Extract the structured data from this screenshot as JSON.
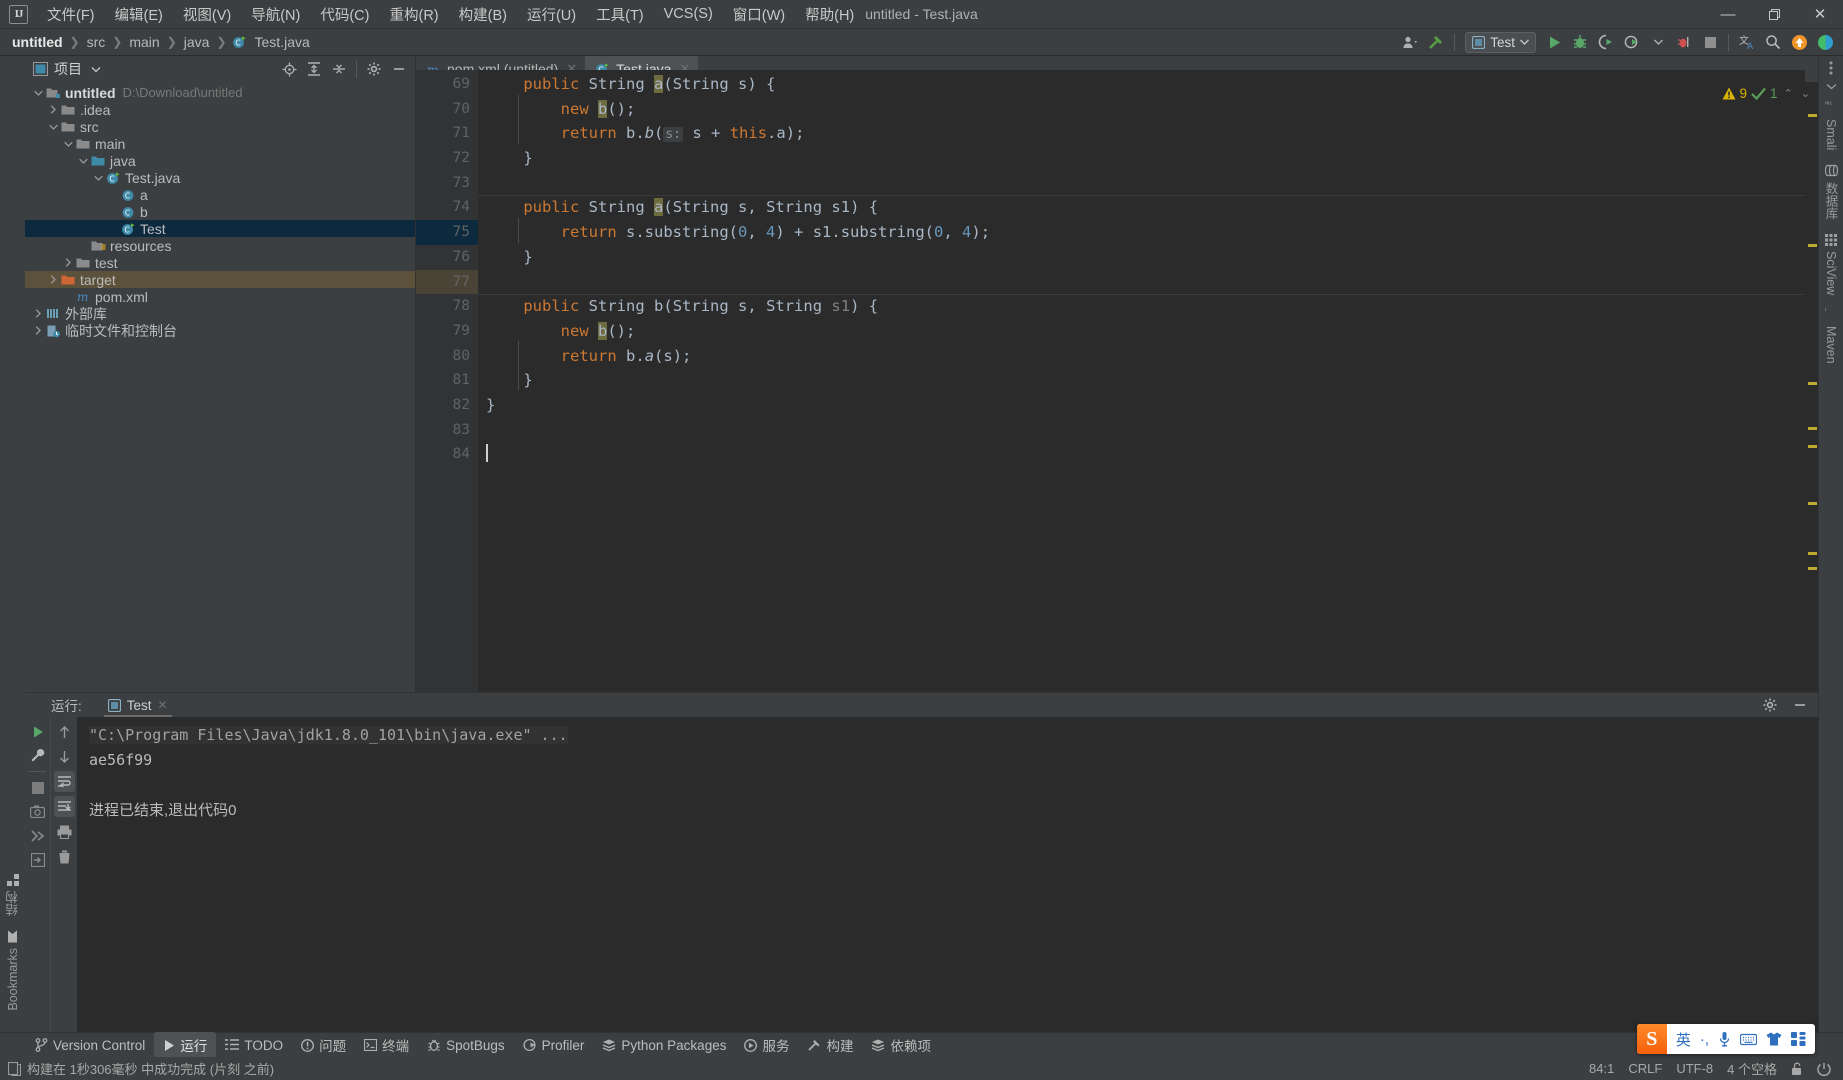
{
  "window": {
    "title": "untitled - Test.java",
    "app_logo": "IJ",
    "minimize": "—",
    "maximize": "❐",
    "close": "✕"
  },
  "menubar": {
    "items": [
      {
        "label": "文件(F)",
        "name": "menu-file"
      },
      {
        "label": "编辑(E)",
        "name": "menu-edit"
      },
      {
        "label": "视图(V)",
        "name": "menu-view"
      },
      {
        "label": "导航(N)",
        "name": "menu-navigate"
      },
      {
        "label": "代码(C)",
        "name": "menu-code"
      },
      {
        "label": "重构(R)",
        "name": "menu-refactor"
      },
      {
        "label": "构建(B)",
        "name": "menu-build"
      },
      {
        "label": "运行(U)",
        "name": "menu-run"
      },
      {
        "label": "工具(T)",
        "name": "menu-tools"
      },
      {
        "label": "VCS(S)",
        "name": "menu-vcs"
      },
      {
        "label": "窗口(W)",
        "name": "menu-window"
      },
      {
        "label": "帮助(H)",
        "name": "menu-help"
      }
    ]
  },
  "navbar": {
    "breadcrumbs": [
      "untitled",
      "src",
      "main",
      "java",
      "Test.java"
    ],
    "separator": "❯",
    "run_config": "Test",
    "toolbar_icons": [
      "user-icon",
      "hammer-icon",
      "run-icon",
      "debug-icon",
      "run-coverage-icon",
      "profiler-icon",
      "stop-icon",
      "translate-icon",
      "search-everywhere-icon",
      "update-icon",
      "ide-theme-icon"
    ]
  },
  "left_rail": {
    "tabs": [
      {
        "label": "结构",
        "name": "rail-structure"
      },
      {
        "label": "Bookmarks",
        "name": "rail-bookmarks"
      }
    ]
  },
  "right_rail": {
    "tabs": [
      {
        "label": "Smali",
        "name": "rail-smali"
      },
      {
        "label": "数据库",
        "name": "rail-database"
      },
      {
        "label": "SciView",
        "name": "rail-sciview"
      },
      {
        "label": "Maven",
        "name": "rail-maven"
      }
    ]
  },
  "project_panel": {
    "title": "项目",
    "header_icons": [
      "locate-icon",
      "expand-all-icon",
      "collapse-all-icon",
      "settings-icon",
      "hide-icon"
    ],
    "tree": [
      {
        "label": "untitled",
        "sub": "D:\\Download\\untitled",
        "depth": 0,
        "arrow": "down",
        "icon": "module-folder",
        "state": "normal"
      },
      {
        "label": ".idea",
        "sub": "",
        "depth": 1,
        "arrow": "right",
        "icon": "folder",
        "state": "normal"
      },
      {
        "label": "src",
        "sub": "",
        "depth": 1,
        "arrow": "down",
        "icon": "folder",
        "state": "normal"
      },
      {
        "label": "main",
        "sub": "",
        "depth": 2,
        "arrow": "down",
        "icon": "folder",
        "state": "normal"
      },
      {
        "label": "java",
        "sub": "",
        "depth": 3,
        "arrow": "down",
        "icon": "source-folder",
        "state": "normal"
      },
      {
        "label": "Test.java",
        "sub": "",
        "depth": 4,
        "arrow": "down",
        "icon": "java-class",
        "state": "normal"
      },
      {
        "label": "a",
        "sub": "",
        "depth": 5,
        "arrow": "none",
        "icon": "class",
        "state": "normal"
      },
      {
        "label": "b",
        "sub": "",
        "depth": 5,
        "arrow": "none",
        "icon": "class",
        "state": "normal"
      },
      {
        "label": "Test",
        "sub": "",
        "depth": 5,
        "arrow": "none",
        "icon": "java-class",
        "state": "selected"
      },
      {
        "label": "resources",
        "sub": "",
        "depth": 3,
        "arrow": "none",
        "icon": "resource-folder",
        "state": "normal"
      },
      {
        "label": "test",
        "sub": "",
        "depth": 2,
        "arrow": "right",
        "icon": "folder",
        "state": "normal"
      },
      {
        "label": "target",
        "sub": "",
        "depth": 1,
        "arrow": "right",
        "icon": "excluded-folder",
        "state": "highlight"
      },
      {
        "label": "pom.xml",
        "sub": "",
        "depth": 2,
        "arrow": "none",
        "icon": "maven-file",
        "state": "normal"
      },
      {
        "label": "外部库",
        "sub": "",
        "depth": 0,
        "arrow": "right",
        "icon": "library",
        "state": "normal"
      },
      {
        "label": "临时文件和控制台",
        "sub": "",
        "depth": 0,
        "arrow": "right",
        "icon": "scratches",
        "state": "normal"
      }
    ]
  },
  "editor": {
    "tabs": [
      {
        "label": "pom.xml (untitled)",
        "icon": "maven-file",
        "active": false,
        "name": "tab-pom-xml"
      },
      {
        "label": "Test.java",
        "icon": "java-class",
        "active": true,
        "name": "tab-test-java"
      }
    ],
    "inspection": {
      "warning_count": "9",
      "ok_count": "1",
      "chev_up": "⌃",
      "chev_down": "⌄"
    },
    "first_line": 69,
    "lines": [
      {
        "n": "69",
        "gutter": "",
        "clipped": true,
        "html": "    <span class='kw'>public</span> <span class='cls'>String</span> <span class='usage'>a</span>(<span class='cls'>String</span> <span class='id'>s</span>) {"
      },
      {
        "n": "70",
        "gutter": "",
        "clipped": false,
        "html": "        <span class='kw'>new</span> <span class='usage'>b</span>();"
      },
      {
        "n": "71",
        "gutter": "",
        "clipped": false,
        "html": "        <span class='kw'>return</span> <span class='id'>b</span>.<span class='ital'>b</span>(<span class='param-hint'>s:</span> <span class='id'>s</span> + <span class='kw'>this</span>.<span class='id'>a</span>);"
      },
      {
        "n": "72",
        "gutter": "",
        "clipped": false,
        "html": "    }"
      },
      {
        "n": "73",
        "gutter": "",
        "clipped": false,
        "html": ""
      },
      {
        "n": "74",
        "gutter": "@",
        "clipped": false,
        "sep": true,
        "html": "    <span class='kw'>public</span> <span class='cls'>String</span> <span class='usage'>a</span>(<span class='cls'>String</span> <span class='id'>s</span>, <span class='cls'>String</span> <span class='id'>s1</span>) {"
      },
      {
        "n": "75",
        "gutter": "",
        "clipped": false,
        "html": "        <span class='kw'>return</span> <span class='id'>s</span>.substring(<span class='num'>0</span>, <span class='num'>4</span>) + <span class='id'>s1</span>.substring(<span class='num'>0</span>, <span class='num'>4</span>);"
      },
      {
        "n": "76",
        "gutter": "",
        "clipped": false,
        "html": "    }"
      },
      {
        "n": "77",
        "gutter": "",
        "clipped": false,
        "html": ""
      },
      {
        "n": "78",
        "gutter": "",
        "clipped": false,
        "sep": true,
        "html": "    <span class='kw'>public</span> <span class='cls'>String</span> <span class='id'>b</span>(<span class='cls'>String</span> <span class='id'>s</span>, <span class='cls'>String</span> <span class='gray'>s1</span>) {"
      },
      {
        "n": "79",
        "gutter": "",
        "clipped": false,
        "html": "        <span class='kw'>new</span> <span class='usage'>b</span>();"
      },
      {
        "n": "80",
        "gutter": "",
        "clipped": false,
        "html": "        <span class='kw'>return</span> <span class='id'>b</span>.<span class='ital'>a</span>(<span class='id'>s</span>);"
      },
      {
        "n": "81",
        "gutter": "",
        "clipped": false,
        "html": "    }"
      },
      {
        "n": "82",
        "gutter": "",
        "clipped": false,
        "html": "}"
      },
      {
        "n": "83",
        "gutter": "",
        "clipped": false,
        "html": ""
      },
      {
        "n": "84",
        "gutter": "",
        "clipped": false,
        "caret": true,
        "html": ""
      }
    ]
  },
  "run_panel": {
    "label": "运行:",
    "tab": "Test",
    "close": "✕",
    "settings_icon": "gear-icon",
    "hide_icon": "minimize-icon",
    "toolbar_left": [
      "rerun-icon",
      "wrench-icon",
      "stop-icon",
      "camera-icon",
      "thread-dump-icon",
      "export-icon"
    ],
    "toolbar_right": [
      "up-icon",
      "down-icon",
      "soft-wrap-icon",
      "scroll-to-end-icon",
      "print-icon",
      "trash-icon"
    ],
    "console": {
      "command": "\"C:\\Program Files\\Java\\jdk1.8.0_101\\bin\\java.exe\" ...",
      "output": "ae56f99",
      "exit_message": "进程已结束,退出代码0"
    }
  },
  "bottom_bar": {
    "items": [
      {
        "label": "Version Control",
        "icon": "branch-icon",
        "active": false,
        "name": "bottom-version-control"
      },
      {
        "label": "运行",
        "icon": "run-icon",
        "active": true,
        "name": "bottom-run"
      },
      {
        "label": "TODO",
        "icon": "list-icon",
        "active": false,
        "name": "bottom-todo"
      },
      {
        "label": "问题",
        "icon": "problem-icon",
        "active": false,
        "name": "bottom-problems"
      },
      {
        "label": "终端",
        "icon": "terminal-icon",
        "active": false,
        "name": "bottom-terminal"
      },
      {
        "label": "SpotBugs",
        "icon": "bug-icon",
        "active": false,
        "name": "bottom-spotbugs"
      },
      {
        "label": "Profiler",
        "icon": "profiler-icon",
        "active": false,
        "name": "bottom-profiler"
      },
      {
        "label": "Python Packages",
        "icon": "package-icon",
        "active": false,
        "name": "bottom-python-packages"
      },
      {
        "label": "服务",
        "icon": "services-icon",
        "active": false,
        "name": "bottom-services"
      },
      {
        "label": "构建",
        "icon": "hammer-icon",
        "active": false,
        "name": "bottom-build"
      },
      {
        "label": "依赖项",
        "icon": "dependency-icon",
        "active": false,
        "name": "bottom-dependencies"
      }
    ]
  },
  "status_bar": {
    "message": "构建在 1秒306毫秒 中成功完成 (片刻 之前)",
    "message_icon": "build-icon",
    "caret_position": "84:1",
    "line_separator": "CRLF",
    "encoding": "UTF-8",
    "indent": "4 个空格",
    "lock_icon": "unlocked-icon",
    "power_icon": "power-save-icon"
  },
  "ime_bar": {
    "logo": "S",
    "items": [
      "英",
      "·,",
      "mic-icon",
      "keyboard-icon",
      "skin-icon",
      "apps-icon"
    ]
  },
  "colors": {
    "accent_blue": "#4a88c7",
    "selection": "#0d293e",
    "highlight": "#5c513a",
    "keyword": "#cc7832",
    "number": "#6897bb",
    "method": "#ffc66d",
    "editor_bg": "#2b2b2b",
    "panel_bg": "#3c3f41",
    "warning": "#d9b400"
  }
}
